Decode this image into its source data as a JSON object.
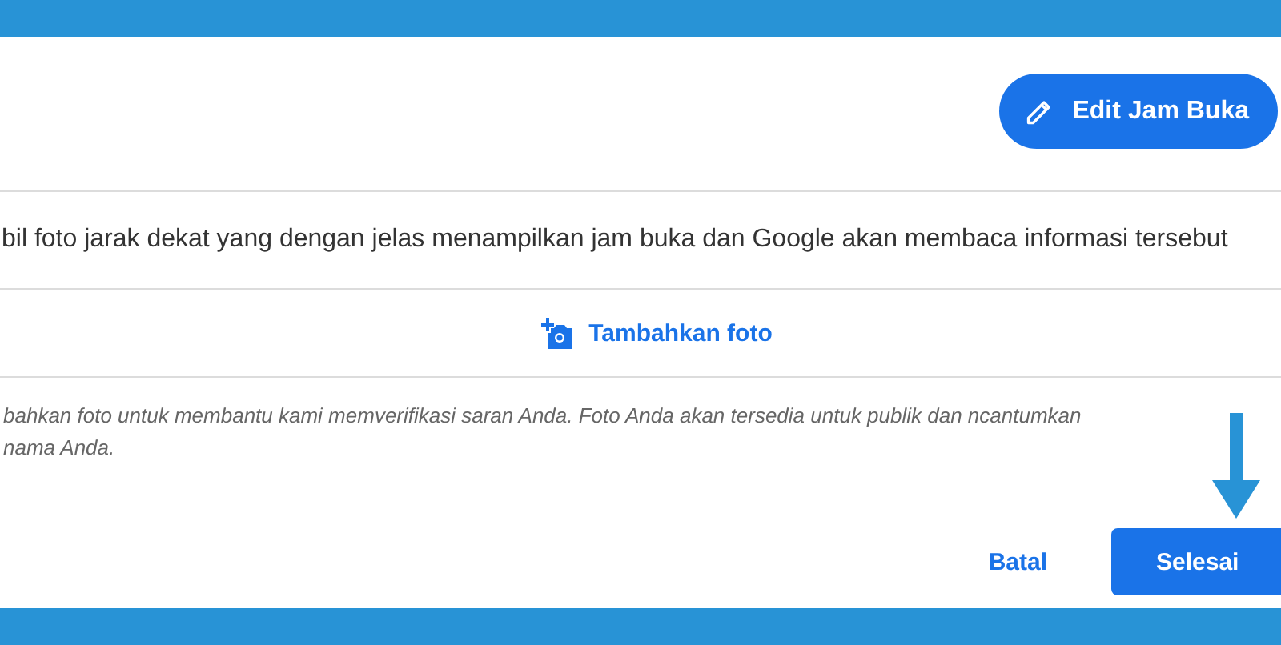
{
  "edit_button": {
    "label": "Edit Jam Buka"
  },
  "instruction": "bil foto jarak dekat yang dengan jelas menampilkan jam buka dan Google akan membaca informasi tersebut",
  "add_photo": {
    "label": "Tambahkan foto"
  },
  "disclaimer": "bahkan foto untuk membantu kami memverifikasi saran Anda. Foto Anda akan tersedia untuk publik dan ncantumkan nama Anda.",
  "buttons": [
    {
      "label": "Batal",
      "kind": "text"
    },
    {
      "label": "Selesai",
      "kind": "filled"
    }
  ]
}
